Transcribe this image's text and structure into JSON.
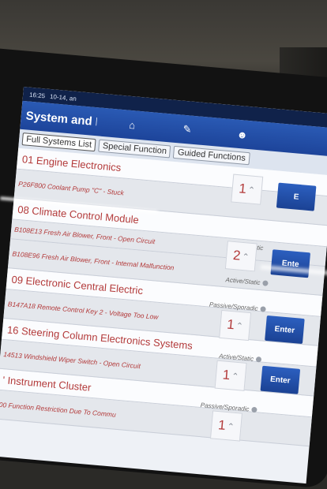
{
  "status_bar": {
    "time": "16:25",
    "date": "10-14, an"
  },
  "header": {
    "title": "System and F",
    "icons": [
      "home-icon",
      "report-icon",
      "user-icon"
    ]
  },
  "tabs": [
    {
      "label": "Full Systems List",
      "active": true
    },
    {
      "label": "Special Function",
      "active": false
    },
    {
      "label": "Guided Functions",
      "active": false
    }
  ],
  "systems": [
    {
      "name": "01 Engine Electronics",
      "dtc": "P26F800 Coolant Pump \"C\" - Stuck",
      "count": "1",
      "status": "",
      "enter_label": "E"
    },
    {
      "name": "08 Climate Control Module",
      "dtc": "B108E13 Fresh Air Blower, Front - Open Circuit",
      "dtc2": "B108E96 Fresh Air Blower, Front - Internal Malfunction",
      "count": "2",
      "status": "Active/Static",
      "status2": "Active/Static",
      "enter_label": "Ente"
    },
    {
      "name": "09 Electronic Central Electric",
      "dtc": "B147A18 Remote Control Key 2 - Voltage Too Low",
      "count": "1",
      "status": "Passive/Sporadic",
      "enter_label": "Enter"
    },
    {
      "name": "16 Steering Column Electronics Systems",
      "dtc": "14513 Windshield Wiper Switch - Open Circuit",
      "count": "1",
      "status": "Active/Static",
      "enter_label": "Enter"
    },
    {
      "name": "' Instrument Cluster",
      "dtc": "00 Function Restriction Due To Commu",
      "count": "1",
      "status": "Passive/Sporadic",
      "enter_label": ""
    }
  ]
}
